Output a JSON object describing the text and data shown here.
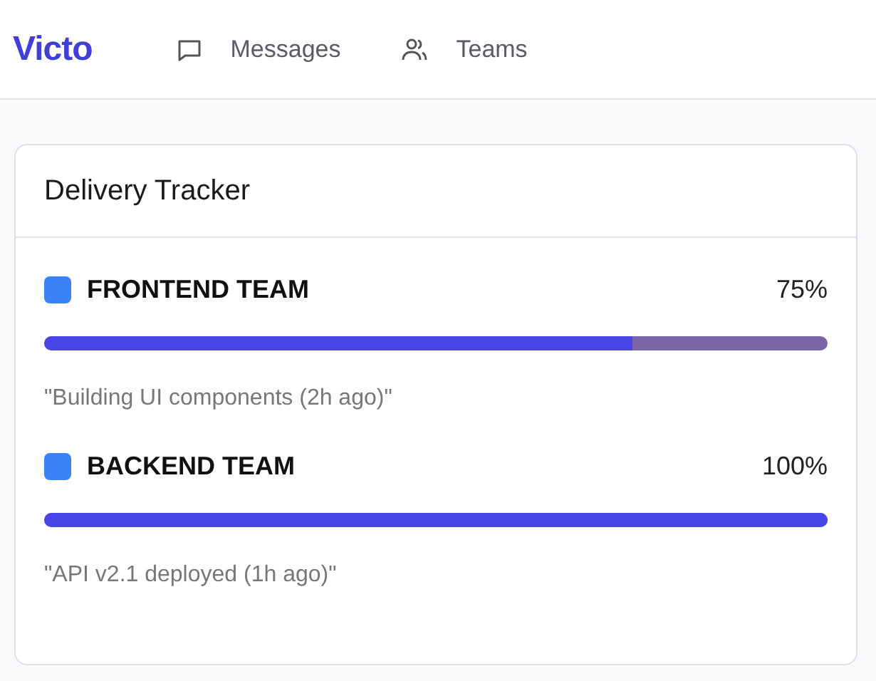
{
  "brand": "Victo",
  "nav": [
    {
      "label": "Messages"
    },
    {
      "label": "Teams"
    }
  ],
  "card": {
    "title": "Delivery Tracker",
    "teams": [
      {
        "name": "FRONTEND TEAM",
        "reading": "75%",
        "level": 0.75,
        "note": "\"Building UI components (2h ago)\""
      },
      {
        "name": "BACKEND TEAM",
        "reading": "100%",
        "level": 1,
        "note": "\"API v2.1 deployed (1h ago)\""
      }
    ]
  }
}
